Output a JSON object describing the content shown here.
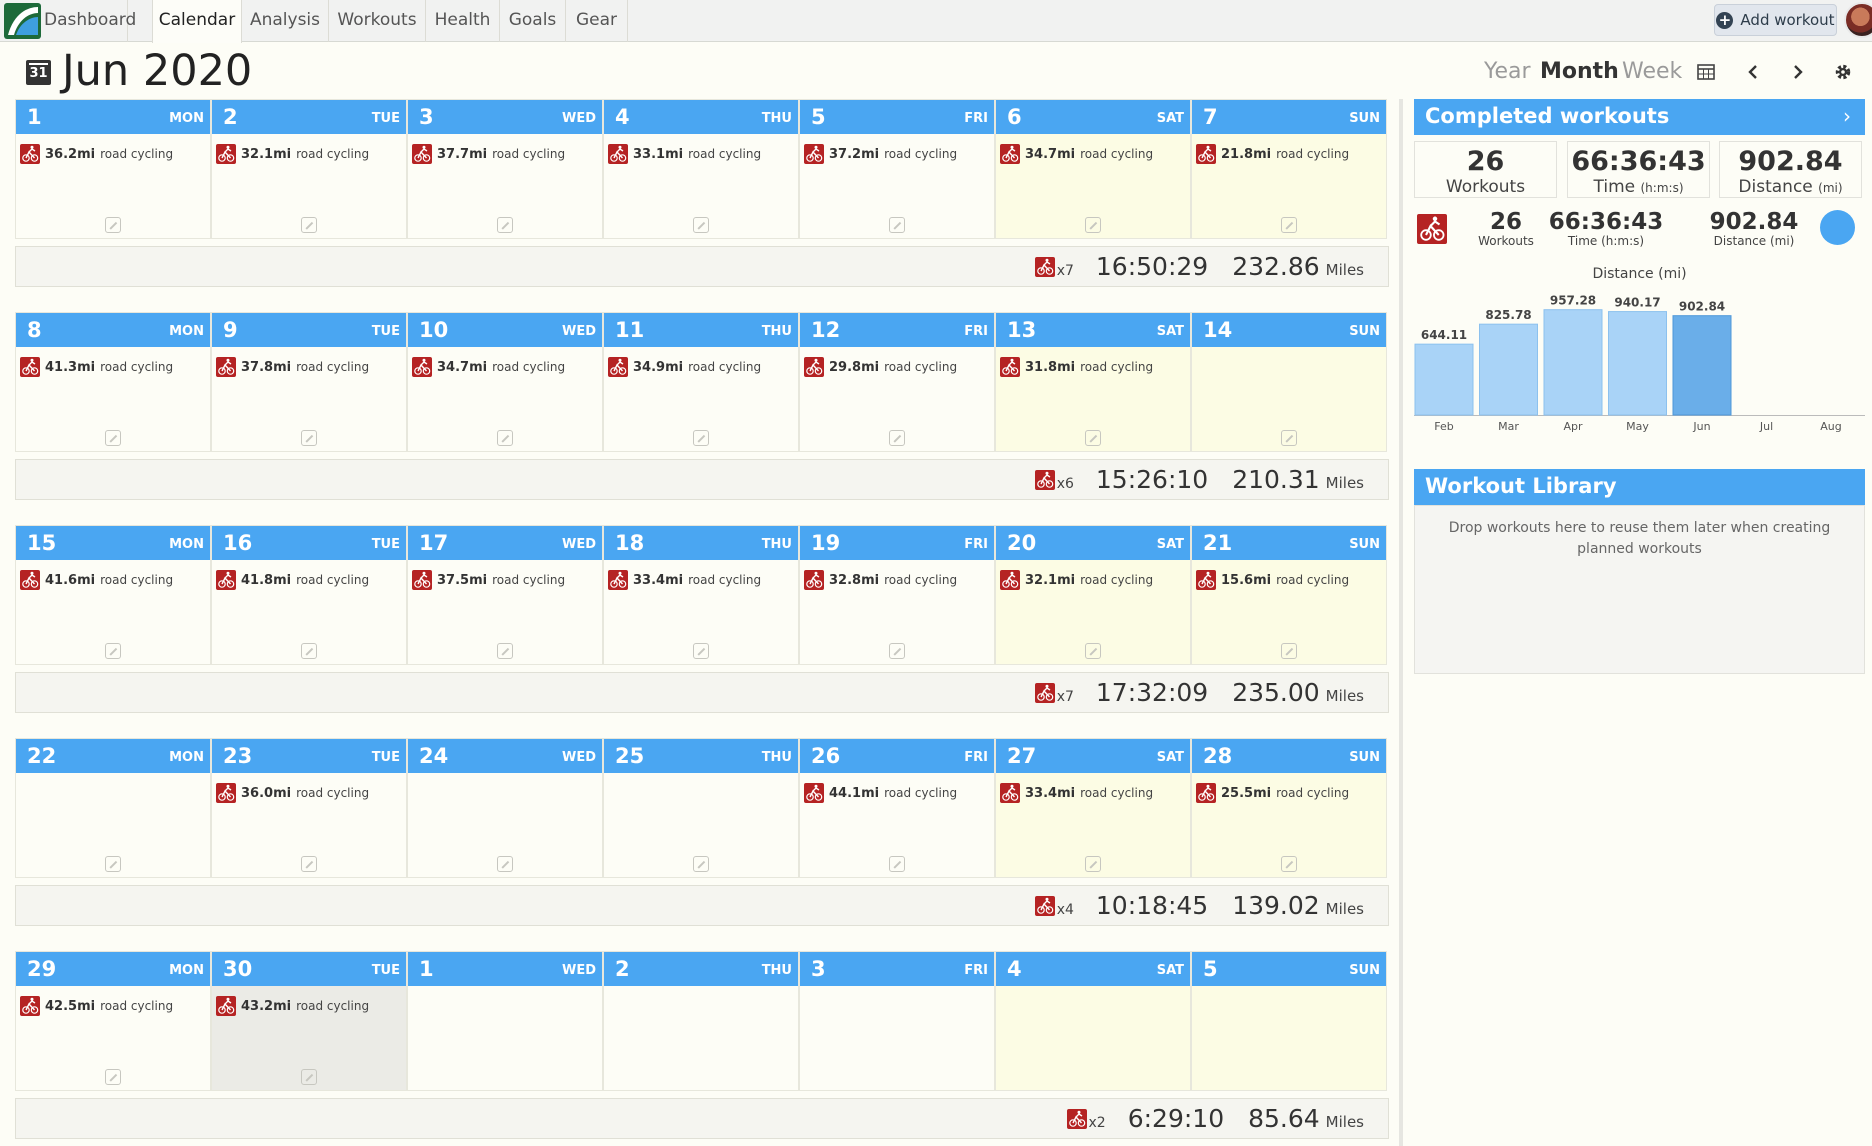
{
  "nav": {
    "tabs": [
      "Dashboard",
      "Calendar",
      "Analysis",
      "Workouts",
      "Health",
      "Goals",
      "Gear"
    ],
    "active_tab": "Calendar",
    "add_workout_label": "Add workout"
  },
  "header": {
    "calendar_icon_label": "31",
    "title": "Jun 2020",
    "views": [
      "Year",
      "Month",
      "Week"
    ],
    "active_view": "Month"
  },
  "day_names": [
    "MON",
    "TUE",
    "WED",
    "THU",
    "FRI",
    "SAT",
    "SUN"
  ],
  "weeks": [
    {
      "days": [
        {
          "num": "1",
          "workout": {
            "distance": "36.2mi",
            "type": "road cycling"
          }
        },
        {
          "num": "2",
          "workout": {
            "distance": "32.1mi",
            "type": "road cycling"
          }
        },
        {
          "num": "3",
          "workout": {
            "distance": "37.7mi",
            "type": "road cycling"
          }
        },
        {
          "num": "4",
          "workout": {
            "distance": "33.1mi",
            "type": "road cycling"
          }
        },
        {
          "num": "5",
          "workout": {
            "distance": "37.2mi",
            "type": "road cycling"
          }
        },
        {
          "num": "6",
          "workout": {
            "distance": "34.7mi",
            "type": "road cycling"
          }
        },
        {
          "num": "7",
          "workout": {
            "distance": "21.8mi",
            "type": "road cycling"
          }
        }
      ],
      "summary": {
        "count": "x7",
        "time": "16:50:29",
        "miles": "232.86",
        "unit": "Miles"
      }
    },
    {
      "days": [
        {
          "num": "8",
          "workout": {
            "distance": "41.3mi",
            "type": "road cycling"
          }
        },
        {
          "num": "9",
          "workout": {
            "distance": "37.8mi",
            "type": "road cycling"
          }
        },
        {
          "num": "10",
          "workout": {
            "distance": "34.7mi",
            "type": "road cycling"
          }
        },
        {
          "num": "11",
          "workout": {
            "distance": "34.9mi",
            "type": "road cycling"
          }
        },
        {
          "num": "12",
          "workout": {
            "distance": "29.8mi",
            "type": "road cycling"
          }
        },
        {
          "num": "13",
          "workout": {
            "distance": "31.8mi",
            "type": "road cycling"
          }
        },
        {
          "num": "14",
          "workout": null
        }
      ],
      "summary": {
        "count": "x6",
        "time": "15:26:10",
        "miles": "210.31",
        "unit": "Miles"
      }
    },
    {
      "days": [
        {
          "num": "15",
          "workout": {
            "distance": "41.6mi",
            "type": "road cycling"
          }
        },
        {
          "num": "16",
          "workout": {
            "distance": "41.8mi",
            "type": "road cycling"
          }
        },
        {
          "num": "17",
          "workout": {
            "distance": "37.5mi",
            "type": "road cycling"
          }
        },
        {
          "num": "18",
          "workout": {
            "distance": "33.4mi",
            "type": "road cycling"
          }
        },
        {
          "num": "19",
          "workout": {
            "distance": "32.8mi",
            "type": "road cycling"
          }
        },
        {
          "num": "20",
          "workout": {
            "distance": "32.1mi",
            "type": "road cycling"
          }
        },
        {
          "num": "21",
          "workout": {
            "distance": "15.6mi",
            "type": "road cycling"
          }
        }
      ],
      "summary": {
        "count": "x7",
        "time": "17:32:09",
        "miles": "235.00",
        "unit": "Miles"
      }
    },
    {
      "days": [
        {
          "num": "22",
          "workout": null
        },
        {
          "num": "23",
          "workout": {
            "distance": "36.0mi",
            "type": "road cycling"
          }
        },
        {
          "num": "24",
          "workout": null
        },
        {
          "num": "25",
          "workout": null
        },
        {
          "num": "26",
          "workout": {
            "distance": "44.1mi",
            "type": "road cycling"
          }
        },
        {
          "num": "27",
          "workout": {
            "distance": "33.4mi",
            "type": "road cycling"
          }
        },
        {
          "num": "28",
          "workout": {
            "distance": "25.5mi",
            "type": "road cycling"
          }
        }
      ],
      "summary": {
        "count": "x4",
        "time": "10:18:45",
        "miles": "139.02",
        "unit": "Miles"
      }
    },
    {
      "days": [
        {
          "num": "29",
          "workout": {
            "distance": "42.5mi",
            "type": "road cycling"
          }
        },
        {
          "num": "30",
          "workout": {
            "distance": "43.2mi",
            "type": "road cycling"
          },
          "selected": true
        },
        {
          "num": "1",
          "workout": null,
          "other_month": true
        },
        {
          "num": "2",
          "workout": null,
          "other_month": true
        },
        {
          "num": "3",
          "workout": null,
          "other_month": true
        },
        {
          "num": "4",
          "workout": null,
          "other_month": true
        },
        {
          "num": "5",
          "workout": null,
          "other_month": true
        }
      ],
      "summary": {
        "count": "x2",
        "time": "6:29:10",
        "miles": "85.64",
        "unit": "Miles"
      }
    }
  ],
  "completed": {
    "title": "Completed workouts",
    "totals": [
      {
        "value": "26",
        "label": "Workouts",
        "unit": ""
      },
      {
        "value": "66:36:43",
        "label": "Time",
        "unit": "(h:m:s)"
      },
      {
        "value": "902.84",
        "label": "Distance",
        "unit": "(mi)"
      }
    ],
    "by_type": [
      {
        "value": "26",
        "label": "Workouts"
      },
      {
        "value": "66:36:43",
        "label": "Time (h:m:s)"
      },
      {
        "value": "902.84",
        "label": "Distance (mi)"
      }
    ],
    "type_color": "#4aa6f2"
  },
  "chart_data": {
    "type": "bar",
    "title": "Distance (mi)",
    "categories": [
      "Feb",
      "Mar",
      "Apr",
      "May",
      "Jun",
      "Jul",
      "Aug"
    ],
    "values": [
      644.11,
      825.78,
      957.28,
      940.17,
      902.84,
      null,
      null
    ],
    "value_labels": [
      "644.11",
      "825.78",
      "957.28",
      "940.17",
      "902.84",
      "",
      ""
    ],
    "highlight": "Jun",
    "ylim": [
      0,
      1000
    ],
    "colors": {
      "bar": "#a9d3f7",
      "highlight": "#6aaee9"
    }
  },
  "library": {
    "title": "Workout Library",
    "empty_text": "Drop workouts here to reuse them later when creating planned workouts"
  }
}
